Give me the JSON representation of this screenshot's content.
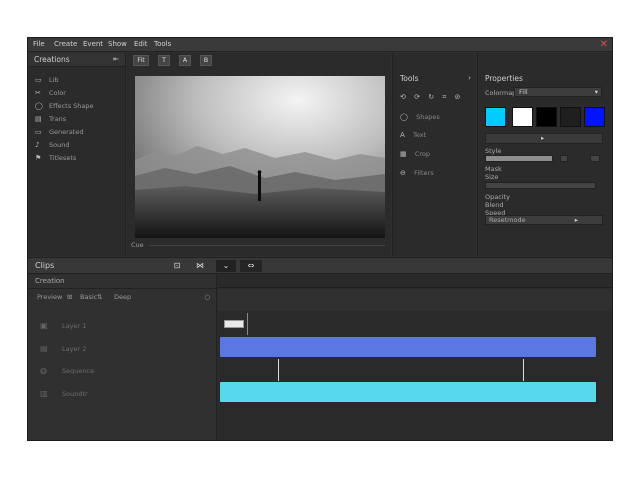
{
  "menu": {
    "items": [
      "File",
      "Create",
      "Event",
      "Show",
      "Edit",
      "Tools"
    ]
  },
  "left_panel": {
    "title": "Creations",
    "items": [
      {
        "label": "Lib",
        "icon": "folder-icon"
      },
      {
        "label": "Color",
        "icon": "scissors-icon"
      },
      {
        "label": "Effects Shape",
        "icon": "circle-icon"
      },
      {
        "label": "Trans",
        "icon": "film-icon"
      },
      {
        "label": "Generated",
        "icon": "frame-icon"
      },
      {
        "label": "Sound",
        "icon": "music-icon"
      },
      {
        "label": "Titlesets",
        "icon": "flag-icon"
      }
    ]
  },
  "viewer": {
    "toolbar": [
      "Fit",
      "T",
      "A",
      "B"
    ],
    "footer": "Cue"
  },
  "tools": {
    "title": "Tools",
    "rows": [
      "Shapes",
      "Text",
      "Crop",
      "Filters"
    ]
  },
  "props": {
    "title": "Properties",
    "dropdown_label": "Colormap",
    "dropdown_value": "Fill",
    "swatch_colors": [
      "#00ccff",
      "#ffffff",
      "#000000",
      "#1f1f1f",
      "#0014ff"
    ],
    "labels": [
      "Style",
      "Mask",
      "Size",
      "Opacity",
      "Blend",
      "Speed"
    ],
    "reset_label": "Resetmode"
  },
  "timeline": {
    "title": "Clips",
    "subtitle": "Creation",
    "filters": [
      "Preview",
      "Basic",
      "Deep"
    ],
    "tracks": [
      {
        "label": "Layer 1",
        "icon": "image-icon"
      },
      {
        "label": "Layer 2",
        "icon": "video-icon"
      },
      {
        "label": "Sequence",
        "icon": "audio-icon"
      },
      {
        "label": "Soundtr",
        "icon": "music-icon"
      }
    ],
    "clip_colors": {
      "blue": "#5a78e0",
      "cyan": "#57d8ec"
    }
  }
}
